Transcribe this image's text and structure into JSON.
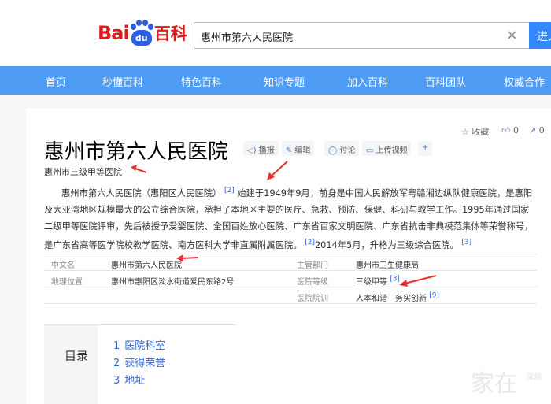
{
  "header": {
    "logo": {
      "bai": "Bai",
      "du": "du",
      "baike": "百科"
    },
    "search": {
      "value": "惠州市第六人民医院",
      "clear_icon": "close-icon",
      "button": "进入"
    }
  },
  "nav": [
    "首页",
    "秒懂百科",
    "特色百科",
    "知识专题",
    "加入百科",
    "百科团队",
    "权威合作"
  ],
  "tools": {
    "collect": "收藏",
    "like_count": "0",
    "share_count": "0"
  },
  "entry": {
    "title": "惠州市第六人民医院",
    "subtitle": "惠州市三级甲等医院",
    "actions": [
      "播报",
      "编辑",
      "讨论",
      "上传视频"
    ],
    "plus": "+"
  },
  "summary": {
    "p1": "惠州市第六人民医院（惠阳区人民医院）",
    "ref1": "[2]",
    "p2": "始建于1949年9月，前身是中国人民解放军粤赣湘边纵队健康医院，是惠阳及大亚湾地区规模最大的公立综合医院，承担了本地区主要的医疗、急救、预防、保健、科研与教学工作。1995年通过国家二级甲等医院评审，先后被授予爱婴医院、全国百姓放心医院、广东省百家文明医院、广东省抗击非典模范集体等荣誉称号，是广东省高等医学院校教学医院、南方医科大学非直属附属医院。",
    "ref2": "[2]",
    "p3": "2014年5月，升格为三级综合医院。",
    "ref3": "[3]"
  },
  "infobox": {
    "left": [
      {
        "key": "中文名",
        "value": "惠州市第六人民医院"
      },
      {
        "key": "地理位置",
        "value": "惠州市惠阳区淡水街道爱民东路2号"
      }
    ],
    "right": [
      {
        "key": "主管部门",
        "value": "惠州市卫生健康局",
        "ref": ""
      },
      {
        "key": "医院等级",
        "value": "三级甲等",
        "ref": "[3]"
      },
      {
        "key": "医院院训",
        "value": "人本和谐　务实创新",
        "ref": "[9]"
      }
    ]
  },
  "toc": {
    "title": "目录",
    "items": [
      {
        "num": "1",
        "label": "医院科室"
      },
      {
        "num": "2",
        "label": "获得荣誉"
      },
      {
        "num": "3",
        "label": "地址"
      }
    ]
  },
  "watermark": {
    "main": "家在",
    "small": "深圳"
  },
  "colors": {
    "nav": "#4e9cf3",
    "search_button": "#3388ff",
    "arrow": "#e8322f",
    "link": "#3366cc"
  }
}
